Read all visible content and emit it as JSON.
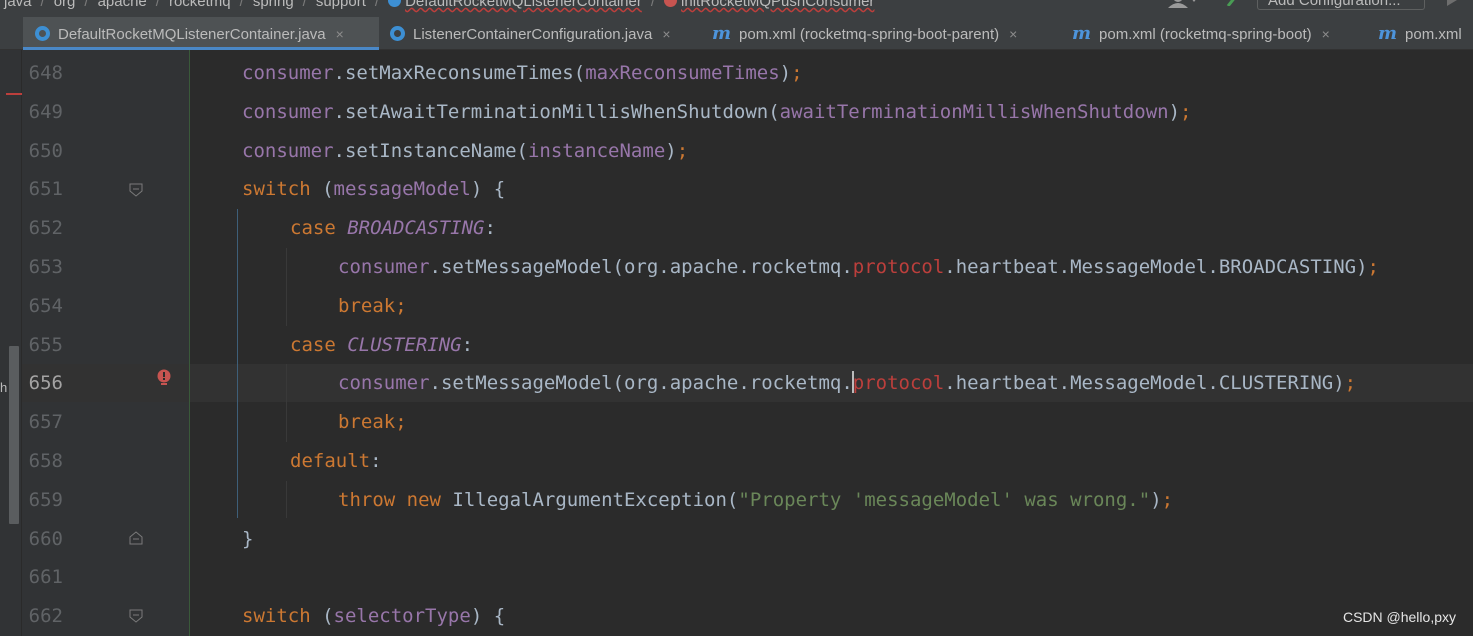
{
  "breadcrumb": {
    "items": [
      "java",
      "org",
      "apache",
      "rocketmq",
      "spring",
      "support",
      "DefaultRocketMQListenerContainer",
      "initRocketMQPushConsumer"
    ],
    "add_configuration": "Add Configuration..."
  },
  "tabs": [
    {
      "label": "DefaultRocketMQListenerContainer.java",
      "icon": "java-class-icon",
      "active": true
    },
    {
      "label": "ListenerContainerConfiguration.java",
      "icon": "java-class-icon",
      "active": false
    },
    {
      "label": "pom.xml (rocketmq-spring-boot-parent)",
      "icon": "maven-icon",
      "active": false
    },
    {
      "label": "pom.xml (rocketmq-spring-boot)",
      "icon": "maven-icon",
      "active": false
    },
    {
      "label": "pom.xml",
      "icon": "maven-icon",
      "active": false
    }
  ],
  "maven_icon_glyph": "m",
  "close_glyph": "×",
  "side_letter": "h",
  "editor": {
    "current_line": 656,
    "lines": [
      {
        "n": "648",
        "tokens": [
          {
            "t": "consumer",
            "c": "fld"
          },
          {
            "t": ".setMaxReconsumeTimes("
          },
          {
            "t": "maxReconsumeTimes",
            "c": "fld"
          },
          {
            "t": ")"
          },
          {
            "t": ";",
            "c": "kw"
          }
        ]
      },
      {
        "n": "649",
        "tokens": [
          {
            "t": "consumer",
            "c": "fld"
          },
          {
            "t": ".setAwaitTerminationMillisWhenShutdown("
          },
          {
            "t": "awaitTerminationMillisWhenShutdown",
            "c": "fld"
          },
          {
            "t": ")"
          },
          {
            "t": ";",
            "c": "kw"
          }
        ]
      },
      {
        "n": "650",
        "tokens": [
          {
            "t": "consumer",
            "c": "fld"
          },
          {
            "t": ".setInstanceName("
          },
          {
            "t": "instanceName",
            "c": "fld"
          },
          {
            "t": ")"
          },
          {
            "t": ";",
            "c": "kw"
          }
        ]
      },
      {
        "n": "651",
        "tokens": [
          {
            "t": "switch ",
            "c": "kw"
          },
          {
            "t": "("
          },
          {
            "t": "messageModel",
            "c": "fld"
          },
          {
            "t": ") {"
          }
        ]
      },
      {
        "n": "652",
        "tokens": [
          {
            "t": "case ",
            "c": "kw"
          },
          {
            "t": "BROADCASTING",
            "c": "enumc"
          },
          {
            "t": ":"
          }
        ]
      },
      {
        "n": "653",
        "tokens": [
          {
            "t": "consumer",
            "c": "fld"
          },
          {
            "t": ".setMessageModel(org.apache.rocketmq."
          },
          {
            "t": "protocol",
            "c": "red"
          },
          {
            "t": ".heartbeat.MessageModel.BROADCASTING)"
          },
          {
            "t": ";",
            "c": "kw"
          }
        ]
      },
      {
        "n": "654",
        "tokens": [
          {
            "t": "break;",
            "c": "kw"
          }
        ]
      },
      {
        "n": "655",
        "tokens": [
          {
            "t": "case ",
            "c": "kw"
          },
          {
            "t": "CLUSTERING",
            "c": "enumc"
          },
          {
            "t": ":"
          }
        ]
      },
      {
        "n": "656",
        "tokens": [
          {
            "t": "consumer",
            "c": "fld"
          },
          {
            "t": ".setMessageModel(org.apache.rocketmq."
          },
          {
            "t": "|",
            "c": "caret"
          },
          {
            "t": "protocol",
            "c": "red"
          },
          {
            "t": ".heartbeat.MessageModel.CLUSTERING)"
          },
          {
            "t": ";",
            "c": "kw"
          }
        ]
      },
      {
        "n": "657",
        "tokens": [
          {
            "t": "break;",
            "c": "kw"
          }
        ]
      },
      {
        "n": "658",
        "tokens": [
          {
            "t": "default",
            "c": "kw"
          },
          {
            "t": ":"
          }
        ]
      },
      {
        "n": "659",
        "tokens": [
          {
            "t": "throw new ",
            "c": "kw"
          },
          {
            "t": "IllegalArgumentException("
          },
          {
            "t": "\"Property 'messageModel' was wrong.\"",
            "c": "str"
          },
          {
            "t": ")"
          },
          {
            "t": ";",
            "c": "kw"
          }
        ]
      },
      {
        "n": "660",
        "tokens": [
          {
            "t": "}"
          }
        ]
      },
      {
        "n": "661",
        "tokens": []
      },
      {
        "n": "662",
        "tokens": [
          {
            "t": "switch ",
            "c": "kw"
          },
          {
            "t": "("
          },
          {
            "t": "selectorType",
            "c": "fld"
          },
          {
            "t": ") {"
          }
        ]
      }
    ]
  },
  "watermark": "CSDN @hello,pxy",
  "colors": {
    "background": "#2b2b2b",
    "gutter": "#313335",
    "keyword": "#cc7832",
    "field": "#9876aa",
    "string": "#6a8759",
    "error": "#bc3f3c",
    "text": "#a9b7c6",
    "accent": "#4a88c7"
  }
}
